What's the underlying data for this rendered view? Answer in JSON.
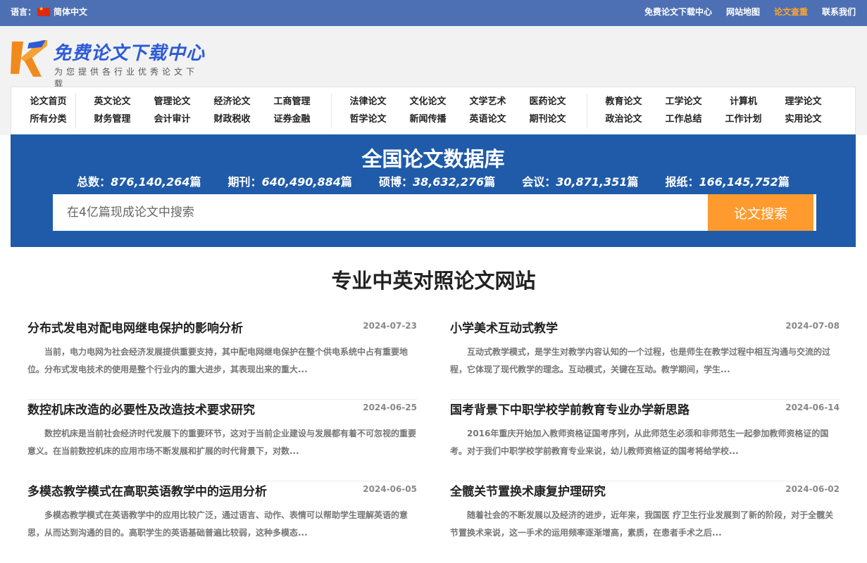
{
  "topbar": {
    "lang_label": "语言：",
    "lang_value": "简体中文",
    "links": [
      "免费论文下载中心",
      "网站地图",
      "论文查重",
      "联系我们"
    ]
  },
  "logo": {
    "title": "免费论文下载中心",
    "subtitle": "为您提供各行业优秀论文下载"
  },
  "nav": {
    "group1": [
      "论文首页",
      "所有分类"
    ],
    "group2": [
      "英文论文",
      "财务管理",
      "管理论文",
      "会计审计",
      "经济论文",
      "财政税收",
      "工商管理",
      "证券金融"
    ],
    "group3": [
      "法律论文",
      "哲学论文",
      "文化论文",
      "新闻传播",
      "文学艺术",
      "英语论文",
      "医药论文",
      "期刊论文"
    ],
    "group4": [
      "教育论文",
      "政治论文",
      "工学论文",
      "工作总结",
      "计算机",
      "工作计划",
      "理学论文",
      "实用论文"
    ]
  },
  "banner": {
    "title": "全国论文数据库",
    "stats": [
      {
        "label": "总数：",
        "value": "876,140,264",
        "unit": "篇"
      },
      {
        "label": "期刊：",
        "value": "640,490,884",
        "unit": "篇"
      },
      {
        "label": "硕博：",
        "value": "38,632,276",
        "unit": "篇"
      },
      {
        "label": "会议：",
        "value": "30,871,351",
        "unit": "篇"
      },
      {
        "label": "报纸：",
        "value": "166,145,752",
        "unit": "篇"
      }
    ],
    "search_placeholder": "在4亿篇现成论文中搜索",
    "search_button": "论文搜索"
  },
  "section_title": "专业中英对照论文网站",
  "articles": [
    {
      "title": "分布式发电对配电网继电保护的影响分析",
      "date": "2024-07-23",
      "summary": "当前，电力电网为社会经济发展提供重要支持，其中配电网继电保护在整个供电系统中占有重要地位。分布式发电技术的使用是整个行业内的重大进步，其表现出来的重大..."
    },
    {
      "title": "小学美术互动式教学",
      "date": "2024-07-08",
      "summary": "互动式教学模式，是学生对教学内容认知的一个过程，也是师生在教学过程中相互沟通与交流的过程，它体现了现代教学的理念。互动模式，关键在互动。教学期间，学生..."
    },
    {
      "title": "数控机床改造的必要性及改造技术要求研究",
      "date": "2024-06-25",
      "summary": "数控机床是当前社会经济时代发展下的重要环节，这对于当前企业建设与发展都有着不可忽视的重要意义。在当前数控机床的应用市场不断发展和扩展的时代背景下，对数..."
    },
    {
      "title": "国考背景下中职学校学前教育专业办学新思路",
      "date": "2024-06-14",
      "summary": "2016年重庆开始加入教师资格证国考序列，从此师范生必须和非师范生一起参加教师资格证的国考。对于我们中职学校学前教育专业来说，幼儿教师资格证的国考将给学校..."
    },
    {
      "title": "多模态教学模式在高职英语教学中的运用分析",
      "date": "2024-06-05",
      "summary": "多模态教学模式在英语教学中的应用比较广泛，通过语言、动作、表情可以帮助学生理解英语的意思，从而达到沟通的目的。高职学生的英语基础普遍比较弱，这种多模态..."
    },
    {
      "title": "全髋关节置换术康复护理研究",
      "date": "2024-06-02",
      "summary": "随着社会的不断发展以及经济的进步，近年来，我国医 疗卫生行业发展到了新的阶段，对于全髋关节置换术来说，这一手术的运用频率逐渐增高，素质，在患者手术之后..."
    }
  ]
}
